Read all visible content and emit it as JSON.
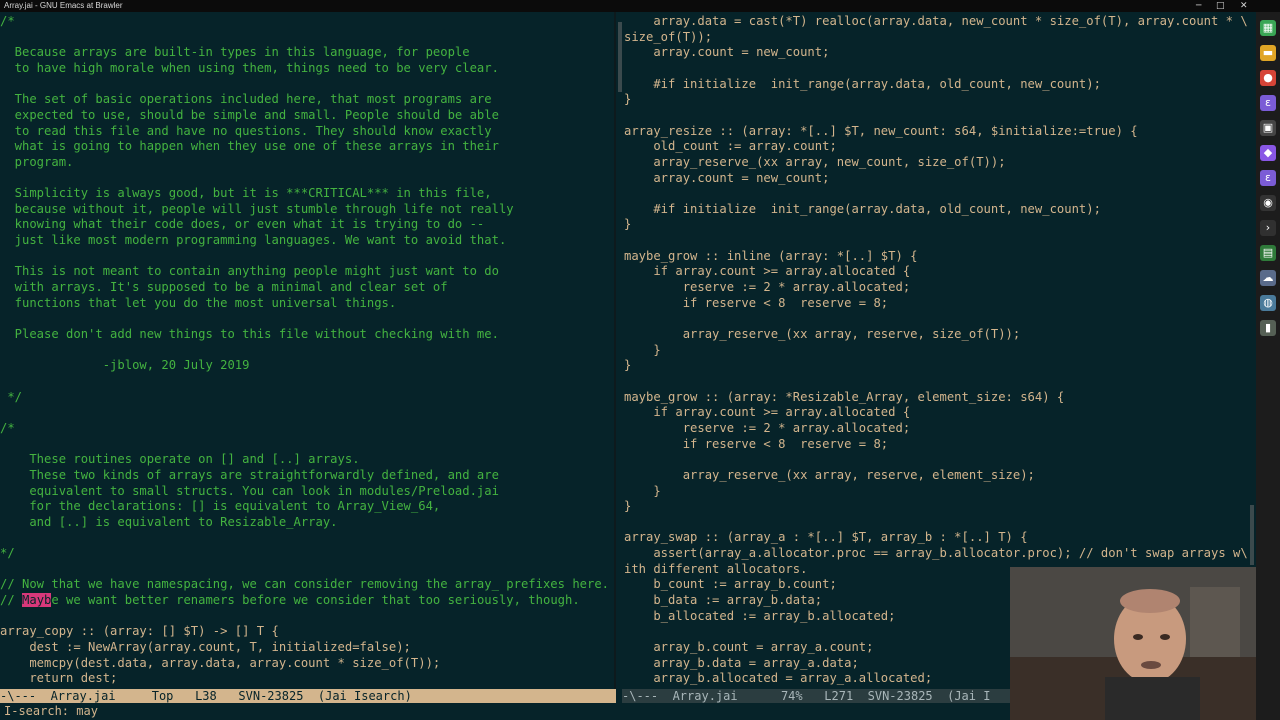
{
  "window": {
    "title": "Array.jai - GNU Emacs at Brawler",
    "min_glyph": "─",
    "max_glyph": "□",
    "close_glyph": "✕"
  },
  "left_pane": {
    "lines": [
      {
        "text": "/*",
        "comment": true
      },
      {
        "text": "",
        "comment": true
      },
      {
        "text": "  Because arrays are built-in types in this language, for people",
        "comment": true
      },
      {
        "text": "  to have high morale when using them, things need to be very clear.",
        "comment": true
      },
      {
        "text": "",
        "comment": true
      },
      {
        "text": "  The set of basic operations included here, that most programs are",
        "comment": true
      },
      {
        "text": "  expected to use, should be simple and small. People should be able",
        "comment": true
      },
      {
        "text": "  to read this file and have no questions. They should know exactly",
        "comment": true
      },
      {
        "text": "  what is going to happen when they use one of these arrays in their",
        "comment": true
      },
      {
        "text": "  program.",
        "comment": true
      },
      {
        "text": "",
        "comment": true
      },
      {
        "text": "  Simplicity is always good, but it is ***CRITICAL*** in this file,",
        "comment": true
      },
      {
        "text": "  because without it, people will just stumble through life not really",
        "comment": true
      },
      {
        "text": "  knowing what their code does, or even what it is trying to do --",
        "comment": true
      },
      {
        "text": "  just like most modern programming languages. We want to avoid that.",
        "comment": true
      },
      {
        "text": "",
        "comment": true
      },
      {
        "text": "  This is not meant to contain anything people might just want to do",
        "comment": true
      },
      {
        "text": "  with arrays. It's supposed to be a minimal and clear set of",
        "comment": true
      },
      {
        "text": "  functions that let you do the most universal things.",
        "comment": true
      },
      {
        "text": "",
        "comment": true
      },
      {
        "text": "  Please don't add new things to this file without checking with me.",
        "comment": true
      },
      {
        "text": "",
        "comment": true
      },
      {
        "text": "              -jblow, 20 July 2019",
        "comment": true
      },
      {
        "text": "",
        "comment": true
      },
      {
        "text": " */",
        "comment": true
      },
      {
        "text": "",
        "comment": true
      },
      {
        "text": "/*",
        "comment": true
      },
      {
        "text": "",
        "comment": true
      },
      {
        "text": "    These routines operate on [] and [..] arrays.",
        "comment": true
      },
      {
        "text": "    These two kinds of arrays are straightforwardly defined, and are",
        "comment": true
      },
      {
        "text": "    equivalent to small structs. You can look in modules/Preload.jai",
        "comment": true
      },
      {
        "text": "    for the declarations: [] is equivalent to Array_View_64,",
        "comment": true
      },
      {
        "text": "    and [..] is equivalent to Resizable_Array.",
        "comment": true
      },
      {
        "text": "",
        "comment": true
      },
      {
        "text": "*/",
        "comment": true
      },
      {
        "text": "",
        "comment": true
      },
      {
        "text": "// Now that we have namespacing, we can consider removing the array_ prefixes here.",
        "comment": true
      },
      {
        "pre": "// ",
        "hl": "Mayb",
        "post": "e we want better renamers before we consider that too seriously, though.",
        "comment": true
      },
      {
        "text": "",
        "comment": false
      },
      {
        "text": "array_copy :: (array: [] $T) -> [] T {",
        "comment": false
      },
      {
        "text": "    dest := NewArray(array.count, T, initialized=false);",
        "comment": false
      },
      {
        "text": "    memcpy(dest.data, array.data, array.count * size_of(T));",
        "comment": false
      },
      {
        "text": "    return dest;",
        "comment": false
      }
    ]
  },
  "right_pane": {
    "lines": [
      {
        "text": "    array.data = cast(*T) realloc(array.data, new_count * size_of(T), array.count * \\"
      },
      {
        "text": "size_of(T));"
      },
      {
        "text": "    array.count = new_count;"
      },
      {
        "text": ""
      },
      {
        "text": "    #if initialize  init_range(array.data, old_count, new_count);"
      },
      {
        "text": "}"
      },
      {
        "text": ""
      },
      {
        "text": "array_resize :: (array: *[..] $T, new_count: s64, $initialize:=true) {"
      },
      {
        "text": "    old_count := array.count;"
      },
      {
        "text": "    array_reserve_(xx array, new_count, size_of(T));"
      },
      {
        "text": "    array.count = new_count;"
      },
      {
        "text": ""
      },
      {
        "text": "    #if initialize  init_range(array.data, old_count, new_count);"
      },
      {
        "text": "}"
      },
      {
        "text": ""
      },
      {
        "text": "maybe_grow :: inline (array: *[..] $T) {"
      },
      {
        "text": "    if array.count >= array.allocated {"
      },
      {
        "text": "        reserve := 2 * array.allocated;"
      },
      {
        "text": "        if reserve < 8  reserve = 8;"
      },
      {
        "text": ""
      },
      {
        "text": "        array_reserve_(xx array, reserve, size_of(T));"
      },
      {
        "text": "    }"
      },
      {
        "text": "}"
      },
      {
        "text": ""
      },
      {
        "text": "maybe_grow :: (array: *Resizable_Array, element_size: s64) {"
      },
      {
        "text": "    if array.count >= array.allocated {"
      },
      {
        "text": "        reserve := 2 * array.allocated;"
      },
      {
        "text": "        if reserve < 8  reserve = 8;"
      },
      {
        "text": ""
      },
      {
        "text": "        array_reserve_(xx array, reserve, element_size);"
      },
      {
        "text": "    }"
      },
      {
        "text": "}"
      },
      {
        "text": ""
      },
      {
        "text": "array_swap :: (array_a : *[..] $T, array_b : *[..] T) {"
      },
      {
        "text": "    assert(array_a.allocator.proc == array_b.allocator.proc); // don't swap arrays w\\"
      },
      {
        "text": "ith different allocators."
      },
      {
        "text": "    b_count := array_b.count;"
      },
      {
        "text": "    b_data := array_b.data;"
      },
      {
        "text": "    b_allocated := array_b.allocated;"
      },
      {
        "text": ""
      },
      {
        "text": "    array_b.count = array_a.count;"
      },
      {
        "text": "    array_b.data = array_a.data;"
      },
      {
        "text": "    array_b.allocated = array_a.allocated;"
      }
    ]
  },
  "modeline_left": "-\\---  Array.jai     Top   L38   SVN-23825  (Jai Isearch)",
  "modeline_right": "-\\---  Array.jai      74%   L271  SVN-23825  (Jai I",
  "echo_area": "I-search: may",
  "taskbar_icons": [
    {
      "name": "grid-icon",
      "glyph": "▦",
      "color": "#3aa655"
    },
    {
      "name": "folder-icon",
      "glyph": "▬",
      "color": "#e0a526"
    },
    {
      "name": "chrome-icon",
      "glyph": "●",
      "color": "#d64437"
    },
    {
      "name": "emacs-icon",
      "glyph": "ε",
      "color": "#7b5cd6"
    },
    {
      "name": "terminal-icon",
      "glyph": "▣",
      "color": "#444444"
    },
    {
      "name": "visual-studio-icon",
      "glyph": "◆",
      "color": "#8957e5"
    },
    {
      "name": "emacs-icon-2",
      "glyph": "ε",
      "color": "#7b5cd6"
    },
    {
      "name": "obs-icon",
      "glyph": "◉",
      "color": "#333333"
    },
    {
      "name": "console-icon",
      "glyph": "›",
      "color": "#303030"
    },
    {
      "name": "app-icon",
      "glyph": "▤",
      "color": "#2f7a3a"
    },
    {
      "name": "cloud-icon",
      "glyph": "☁",
      "color": "#5a6b8a"
    },
    {
      "name": "globe-icon",
      "glyph": "◍",
      "color": "#4a7a9a"
    },
    {
      "name": "battery-icon",
      "glyph": "▮",
      "color": "#556055"
    }
  ],
  "colors": {
    "background": "#062329",
    "code": "#d3b58d",
    "comment": "#44b340",
    "search_highlight": "#d8387a"
  }
}
